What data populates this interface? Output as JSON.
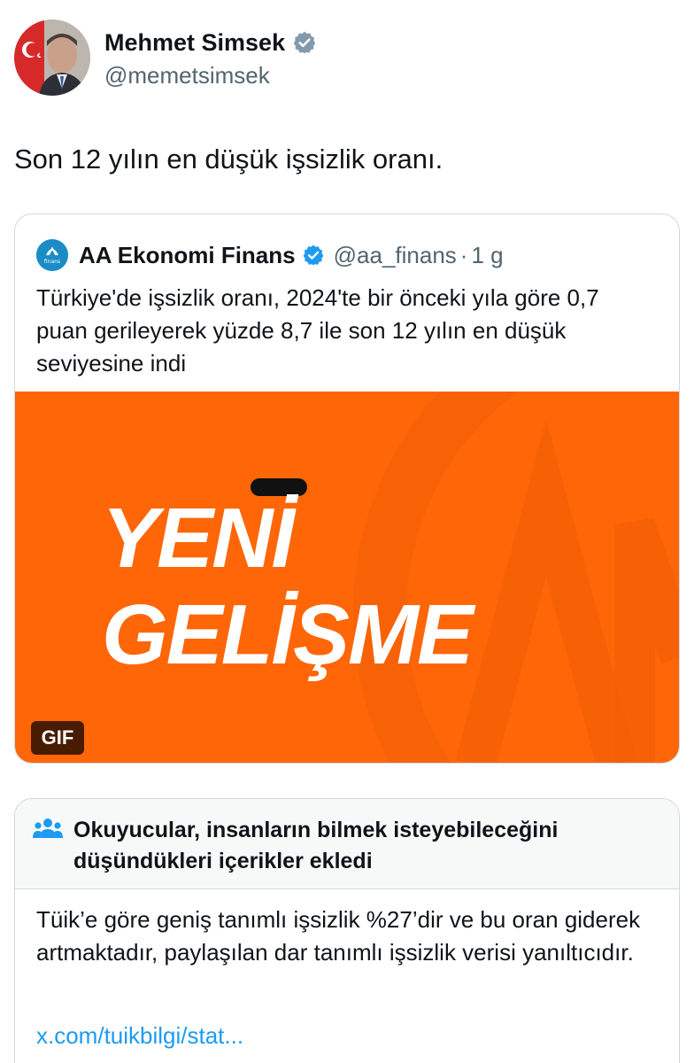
{
  "author": {
    "name": "Mehmet Simsek",
    "handle": "@memetsimsek"
  },
  "tweet": {
    "text": "Son 12 yılın en düşük işsizlik oranı."
  },
  "quote": {
    "name": "AA Ekonomi Finans",
    "handle": "@aa_finans",
    "separator": "·",
    "time": "1 g",
    "avatar_label": "finans",
    "text": "Türkiye'de işsizlik oranı, 2024'te bir önceki yıla göre 0,7 puan gerileyerek yüzde 8,7 ile son 12 yılın en düşük seviyesine indi",
    "media": {
      "line1": "YENİ",
      "line2": "GELİŞME",
      "gif_label": "GIF",
      "background_color": "#fe6608"
    }
  },
  "community_note": {
    "title": "Okuyucular, insanların bilmek isteyebileceğini düşündükleri içerikler ekledi",
    "body": "Tüik’e göre geniş tanımlı işsizlik %27’dir ve bu oran giderek artmaktadır, paylaşılan dar tanımlı işsizlik verisi yanıltıcıdır.",
    "link": "x.com/tuikbilgi/stat..."
  },
  "colors": {
    "verified": "#1d9bf0",
    "link": "#1d9bf0",
    "secondary_text": "#536471"
  }
}
